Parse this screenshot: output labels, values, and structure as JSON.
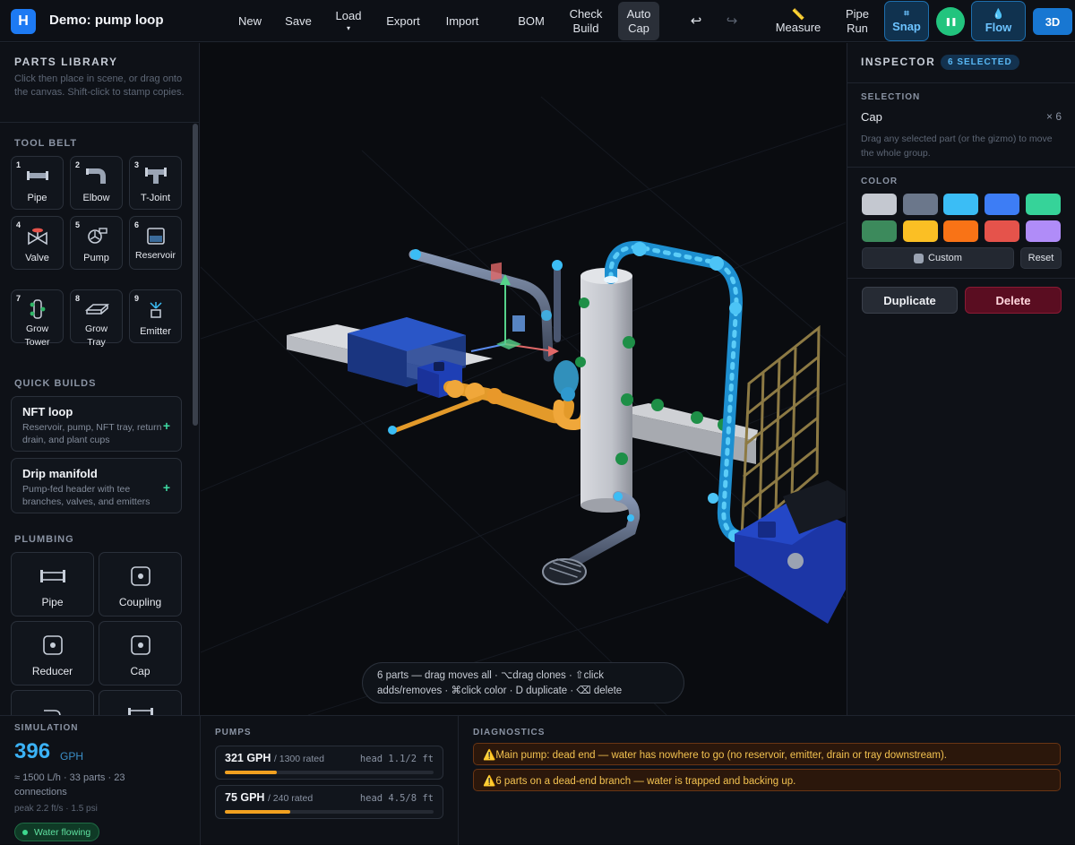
{
  "app": {
    "logo_letter": "H",
    "title": "Demo: pump loop"
  },
  "toolbar": {
    "new": "New",
    "save": "Save",
    "load": "Load",
    "load_caret": "▾",
    "export": "Export",
    "import": "Import",
    "bom": "BOM",
    "check_build_1": "Check",
    "check_build_2": "Build",
    "auto_cap_1": "Auto",
    "auto_cap_2": "Cap",
    "undo": "↩",
    "redo": "↪",
    "measure": "Measure",
    "measure_icon": "📏",
    "pipe_run_1": "Pipe",
    "pipe_run_2": "Run",
    "snap": "Snap",
    "snap_icon": "⌗",
    "pause_icon": "❚❚",
    "flow": "Flow",
    "flow_icon": "💧",
    "view_3d": "3D",
    "accent": "#1d7af3"
  },
  "parts_library": {
    "title": "PARTS LIBRARY",
    "hint": "Click then place in scene, or drag onto the canvas. Shift-click to stamp copies.",
    "tool_belt_title": "TOOL BELT",
    "tool_belt": [
      {
        "num": "1",
        "label": "Pipe",
        "icon": "pipe-icon"
      },
      {
        "num": "2",
        "label": "Elbow",
        "icon": "elbow-icon"
      },
      {
        "num": "3",
        "label": "T-Joint",
        "icon": "tee-icon"
      },
      {
        "num": "4",
        "label": "Valve",
        "icon": "valve-icon"
      },
      {
        "num": "5",
        "label": "Pump",
        "icon": "pump-icon"
      },
      {
        "num": "6",
        "label": "Reservoir",
        "icon": "reservoir-icon"
      },
      {
        "num": "7",
        "label": "Grow Tower",
        "icon": "grow-tower-icon"
      },
      {
        "num": "8",
        "label": "Grow Tray",
        "icon": "grow-tray-icon"
      },
      {
        "num": "9",
        "label": "Emitter",
        "icon": "emitter-icon"
      }
    ],
    "quick_builds_title": "QUICK BUILDS",
    "quick_builds": [
      {
        "title": "NFT loop",
        "desc": "Reservoir, pump, NFT tray, return drain, and plant cups",
        "add": "+"
      },
      {
        "title": "Drip manifold",
        "desc": "Pump-fed header with tee branches, valves, and emitters",
        "add": "+"
      }
    ],
    "plumbing_title": "PLUMBING",
    "plumbing": [
      {
        "label": "Pipe",
        "icon": "pipe-icon"
      },
      {
        "label": "Coupling",
        "icon": "coupling-icon"
      },
      {
        "label": "Reducer",
        "icon": "reducer-icon"
      },
      {
        "label": "Cap",
        "icon": "cap-icon"
      }
    ]
  },
  "viewport": {
    "hint_line1": "6 parts — drag moves all · ⌥drag clones · ⇧click",
    "hint_line2": "adds/removes · ⌘click color · D duplicate · ⌫ delete"
  },
  "inspector": {
    "title": "INSPECTOR",
    "badge": "6 SELECTED",
    "selection_title": "SELECTION",
    "selection_name": "Cap",
    "selection_count": "× 6",
    "selection_hint": "Drag any selected part (or the gizmo) to move the whole group.",
    "color_title": "COLOR",
    "swatches": [
      "#c4c8d0",
      "#6b778b",
      "#3bbdf5",
      "#3d7df5",
      "#36d399",
      "#3c8a5c",
      "#fbbf24",
      "#f97316",
      "#e5534b",
      "#b08cf8"
    ],
    "custom": "Custom",
    "reset": "Reset",
    "duplicate": "Duplicate",
    "delete": "Delete"
  },
  "simulation": {
    "title": "SIMULATION",
    "flow_value": "396",
    "flow_unit": "GPH",
    "summary": "≈ 1500 L/h · 33 parts · 23 connections",
    "peak": "peak 2.2 ft/s · 1.5 psi",
    "status": "Water flowing"
  },
  "pumps": {
    "title": "PUMPS",
    "items": [
      {
        "gph": "321 GPH",
        "rated": "/ 1300 rated",
        "head": "head 1.1/2 ft",
        "fraction": 0.247
      },
      {
        "gph": "75 GPH",
        "rated": "/ 240 rated",
        "head": "head 4.5/8 ft",
        "fraction": 0.3125
      }
    ]
  },
  "diagnostics": {
    "title": "DIAGNOSTICS",
    "items": [
      "⚠️Main pump: dead end — water has nowhere to go (no reservoir, emitter, drain or tray downstream).",
      "⚠️6 parts on a dead-end branch — water is trapped and backing up."
    ]
  }
}
